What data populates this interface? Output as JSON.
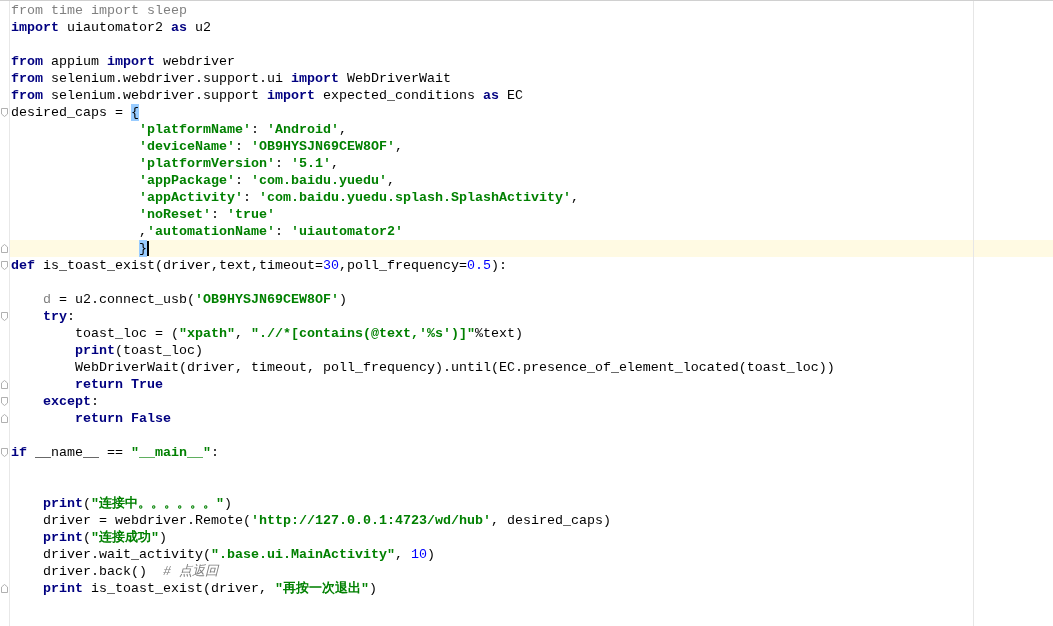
{
  "editor": {
    "lines": [
      {
        "kind": "plain",
        "current": false,
        "tokens": [
          {
            "text": "from time import sleep",
            "kind": "unused"
          }
        ]
      },
      {
        "kind": "plain",
        "current": false,
        "tokens": [
          {
            "text": "import",
            "kind": "kw"
          },
          {
            "text": " uiautomator2 ",
            "kind": "plain"
          },
          {
            "text": "as",
            "kind": "kw"
          },
          {
            "text": " u2",
            "kind": "plain"
          }
        ]
      },
      {
        "kind": "plain",
        "current": false
      },
      {
        "kind": "plain",
        "current": false,
        "tokens": [
          {
            "text": "from",
            "kind": "kw"
          },
          {
            "text": " appium ",
            "kind": "plain"
          },
          {
            "text": "import",
            "kind": "kw"
          },
          {
            "text": " webdriver",
            "kind": "plain"
          }
        ]
      },
      {
        "kind": "plain",
        "current": false,
        "tokens": [
          {
            "text": "from",
            "kind": "kw"
          },
          {
            "text": " selenium.webdriver.support.ui ",
            "kind": "plain"
          },
          {
            "text": "import",
            "kind": "kw"
          },
          {
            "text": " WebDriverWait",
            "kind": "plain"
          }
        ]
      },
      {
        "kind": "plain",
        "current": false,
        "tokens": [
          {
            "text": "from",
            "kind": "kw"
          },
          {
            "text": " selenium.webdriver.support ",
            "kind": "plain"
          },
          {
            "text": "import",
            "kind": "kw"
          },
          {
            "text": " expected_conditions ",
            "kind": "plain"
          },
          {
            "text": "as",
            "kind": "kw"
          },
          {
            "text": " EC",
            "kind": "plain"
          }
        ]
      },
      {
        "kind": "fold-start",
        "current": false,
        "tokens": [
          {
            "text": "desired_caps = ",
            "kind": "plain"
          },
          {
            "text": "{",
            "kind": "match"
          }
        ]
      },
      {
        "kind": "plain",
        "current": false,
        "tokens": [
          {
            "text": "                'platformName'",
            "kind": "str"
          },
          {
            "text": ": ",
            "kind": "plain"
          },
          {
            "text": "'Android'",
            "kind": "str"
          },
          {
            "text": ",",
            "kind": "plain"
          }
        ]
      },
      {
        "kind": "plain",
        "current": false,
        "tokens": [
          {
            "text": "                'deviceName'",
            "kind": "str"
          },
          {
            "text": ": ",
            "kind": "plain"
          },
          {
            "text": "'OB9HYSJN69CEW8OF'",
            "kind": "str"
          },
          {
            "text": ",",
            "kind": "plain"
          }
        ]
      },
      {
        "kind": "plain",
        "current": false,
        "tokens": [
          {
            "text": "                'platformVersion'",
            "kind": "str"
          },
          {
            "text": ": ",
            "kind": "plain"
          },
          {
            "text": "'5.1'",
            "kind": "str"
          },
          {
            "text": ",",
            "kind": "plain"
          }
        ]
      },
      {
        "kind": "plain",
        "current": false,
        "tokens": [
          {
            "text": "                'appPackage'",
            "kind": "str"
          },
          {
            "text": ": ",
            "kind": "plain"
          },
          {
            "text": "'com.baidu.yuedu'",
            "kind": "str"
          },
          {
            "text": ",",
            "kind": "plain"
          }
        ]
      },
      {
        "kind": "plain",
        "current": false,
        "tokens": [
          {
            "text": "                'appActivity'",
            "kind": "str"
          },
          {
            "text": ": ",
            "kind": "plain"
          },
          {
            "text": "'com.baidu.yuedu.splash.SplashActivity'",
            "kind": "str"
          },
          {
            "text": ",",
            "kind": "plain"
          }
        ]
      },
      {
        "kind": "plain",
        "current": false,
        "tokens": [
          {
            "text": "                'noReset'",
            "kind": "str"
          },
          {
            "text": ": ",
            "kind": "plain"
          },
          {
            "text": "'true'",
            "kind": "str"
          }
        ]
      },
      {
        "kind": "plain",
        "current": false,
        "tokens": [
          {
            "text": "                ,",
            "kind": "plain"
          },
          {
            "text": "'automationName'",
            "kind": "str"
          },
          {
            "text": ": ",
            "kind": "plain"
          },
          {
            "text": "'uiautomator2'",
            "kind": "str"
          }
        ]
      },
      {
        "kind": "fold-end",
        "current": true,
        "tokens": [
          {
            "text": "                }",
            "kind": "match"
          }
        ]
      },
      {
        "kind": "fold-start",
        "current": false,
        "tokens": [
          {
            "text": "def",
            "kind": "kw"
          },
          {
            "text": " is_toast_exist(driver,text,timeout=",
            "kind": "plain"
          },
          {
            "text": "30",
            "kind": "num"
          },
          {
            "text": ",poll_frequency=",
            "kind": "plain"
          },
          {
            "text": "0.5",
            "kind": "num"
          },
          {
            "text": "):",
            "kind": "plain"
          }
        ]
      },
      {
        "kind": "plain",
        "current": false
      },
      {
        "kind": "plain",
        "current": false,
        "tokens": [
          {
            "text": "    d",
            "kind": "unused"
          },
          {
            "text": " = u2.connect_usb(",
            "kind": "plain"
          },
          {
            "text": "'OB9HYSJN69CEW8OF'",
            "kind": "str"
          },
          {
            "text": ")",
            "kind": "plain"
          }
        ]
      },
      {
        "kind": "fold-start",
        "current": false,
        "tokens": [
          {
            "text": "    try",
            "kind": "kw"
          },
          {
            "text": ":",
            "kind": "plain"
          }
        ]
      },
      {
        "kind": "plain",
        "current": false,
        "tokens": [
          {
            "text": "        toast_loc = (",
            "kind": "plain"
          },
          {
            "text": "\"xpath\"",
            "kind": "str"
          },
          {
            "text": ", ",
            "kind": "plain"
          },
          {
            "text": "\".//*[contains(@text,'%s')]\"",
            "kind": "str"
          },
          {
            "text": "%text)",
            "kind": "plain"
          }
        ]
      },
      {
        "kind": "plain",
        "current": false,
        "tokens": [
          {
            "text": "        print",
            "kind": "kw"
          },
          {
            "text": "(toast_loc)",
            "kind": "plain"
          }
        ]
      },
      {
        "kind": "plain",
        "current": false,
        "tokens": [
          {
            "text": "        WebDriverWait(driver, timeout, poll_frequency).until(EC.presence_of_element_located(toast_loc))",
            "kind": "plain"
          }
        ]
      },
      {
        "kind": "fold-end",
        "current": false,
        "tokens": [
          {
            "text": "        return True",
            "kind": "kw"
          }
        ]
      },
      {
        "kind": "fold-start",
        "current": false,
        "tokens": [
          {
            "text": "    except",
            "kind": "kw"
          },
          {
            "text": ":",
            "kind": "plain"
          }
        ]
      },
      {
        "kind": "fold-end",
        "current": false,
        "tokens": [
          {
            "text": "        return False",
            "kind": "kw"
          }
        ]
      },
      {
        "kind": "plain",
        "current": false
      },
      {
        "kind": "fold-start",
        "current": false,
        "tokens": [
          {
            "text": "if",
            "kind": "kw"
          },
          {
            "text": " __name__ == ",
            "kind": "plain"
          },
          {
            "text": "\"__main__\"",
            "kind": "str"
          },
          {
            "text": ":",
            "kind": "plain"
          }
        ]
      },
      {
        "kind": "plain",
        "current": false
      },
      {
        "kind": "plain",
        "current": false
      },
      {
        "kind": "plain",
        "current": false,
        "tokens": [
          {
            "text": "    print",
            "kind": "kw"
          },
          {
            "text": "(",
            "kind": "plain"
          },
          {
            "text": "\"连接中。。。。。。\"",
            "kind": "str"
          },
          {
            "text": ")",
            "kind": "plain"
          }
        ]
      },
      {
        "kind": "plain",
        "current": false,
        "tokens": [
          {
            "text": "    driver = webdriver.Remote(",
            "kind": "plain"
          },
          {
            "text": "'http://127.0.0.1:4723/wd/hub'",
            "kind": "str"
          },
          {
            "text": ", desired_caps)",
            "kind": "plain"
          }
        ]
      },
      {
        "kind": "plain",
        "current": false,
        "tokens": [
          {
            "text": "    print",
            "kind": "kw"
          },
          {
            "text": "(",
            "kind": "plain"
          },
          {
            "text": "\"连接成功\"",
            "kind": "str"
          },
          {
            "text": ")",
            "kind": "plain"
          }
        ]
      },
      {
        "kind": "plain",
        "current": false,
        "tokens": [
          {
            "text": "    driver.wait_activity(",
            "kind": "plain"
          },
          {
            "text": "\".base.ui.MainActivity\"",
            "kind": "str"
          },
          {
            "text": ", ",
            "kind": "plain"
          },
          {
            "text": "10",
            "kind": "num"
          },
          {
            "text": ")",
            "kind": "plain"
          }
        ]
      },
      {
        "kind": "plain",
        "current": false,
        "tokens": [
          {
            "text": "    driver.back()  ",
            "kind": "plain"
          },
          {
            "text": "# 点返回",
            "kind": "comment"
          }
        ]
      },
      {
        "kind": "fold-end",
        "current": false,
        "tokens": [
          {
            "text": "    print",
            "kind": "kw"
          },
          {
            "text": " is_toast_exist(driver, ",
            "kind": "plain"
          },
          {
            "text": "\"再按一次退出\"",
            "kind": "str"
          },
          {
            "text": ")",
            "kind": "plain"
          }
        ]
      }
    ]
  }
}
